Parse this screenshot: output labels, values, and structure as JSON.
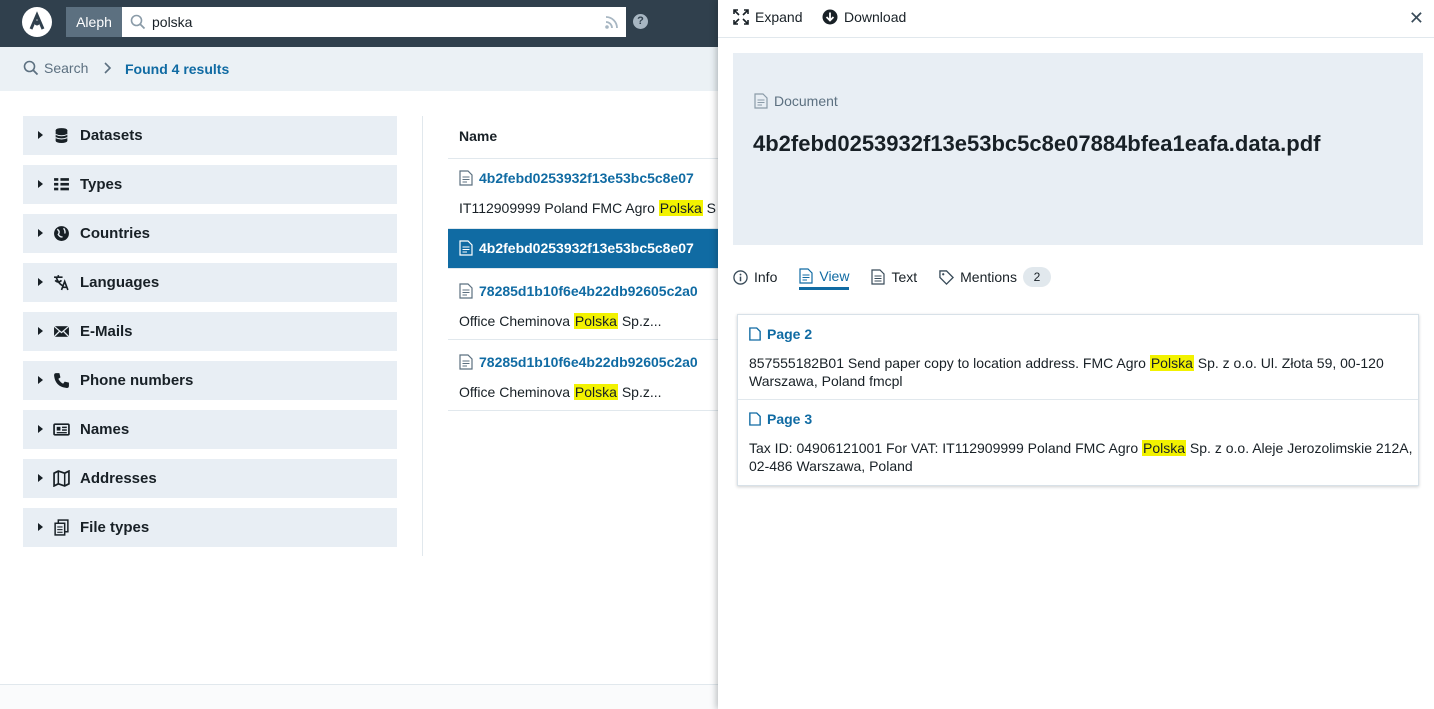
{
  "navbar": {
    "brand": "Aleph",
    "search_value": "polska",
    "logo_icon": "aleph-logo-icon",
    "search_icon": "search-icon",
    "rss_icon": "rss-icon",
    "help_label": "?"
  },
  "breadcrumbs": {
    "search_label": "Search",
    "results_label": "Found 4 results"
  },
  "facets": [
    {
      "label": "Datasets",
      "icon": "database-icon"
    },
    {
      "label": "Types",
      "icon": "list-icon"
    },
    {
      "label": "Countries",
      "icon": "globe-icon"
    },
    {
      "label": "Languages",
      "icon": "translate-icon"
    },
    {
      "label": "E-Mails",
      "icon": "envelope-icon"
    },
    {
      "label": "Phone numbers",
      "icon": "phone-icon"
    },
    {
      "label": "Names",
      "icon": "id-card-icon"
    },
    {
      "label": "Addresses",
      "icon": "map-icon"
    },
    {
      "label": "File types",
      "icon": "documents-icon"
    }
  ],
  "results": {
    "column_header": "Name",
    "rows": [
      {
        "title": "4b2febd0253932f13e53bc5c8e07",
        "snippet_before": "IT112909999 Poland FMC Agro ",
        "snippet_highlight": "Polska",
        "snippet_after": " S",
        "selected": false
      },
      {
        "title": "4b2febd0253932f13e53bc5c8e07",
        "snippet_before": "",
        "snippet_highlight": "",
        "snippet_after": "",
        "selected": true
      },
      {
        "title": "78285d1b10f6e4b22db92605c2a0",
        "snippet_before": "Office Cheminova ",
        "snippet_highlight": "Polska",
        "snippet_after": " Sp.z...",
        "selected": false
      },
      {
        "title": "78285d1b10f6e4b22db92605c2a0",
        "snippet_before": "Office Cheminova ",
        "snippet_highlight": "Polska",
        "snippet_after": " Sp.z...",
        "selected": false
      }
    ]
  },
  "preview": {
    "expand_label": "Expand",
    "download_label": "Download",
    "close_label": "✕",
    "type_label": "Document",
    "title": "4b2febd0253932f13e53bc5c8e07884bfea1eafa.data.pdf",
    "tabs": [
      {
        "label": "Info",
        "icon": "info-icon",
        "active": false
      },
      {
        "label": "View",
        "icon": "document-icon",
        "active": true
      },
      {
        "label": "Text",
        "icon": "text-document-icon",
        "active": false
      },
      {
        "label": "Mentions",
        "icon": "tag-icon",
        "active": false,
        "count": "2"
      }
    ],
    "mentions": [
      {
        "page": "Page 2",
        "before": "857555182B01 Send paper copy to location address. FMC Agro ",
        "highlight": "Polska",
        "after": " Sp. z o.o. Ul. Złota 59, 00-120 Warszawa, Poland fmcpl"
      },
      {
        "page": "Page 3",
        "before": "Tax ID: 04906121001 For VAT: IT112909999 Poland FMC Agro ",
        "highlight": "Polska",
        "after": " Sp. z o.o. Aleje Jerozolimskie 212A, 02-486 Warszawa, Poland"
      }
    ]
  },
  "colors": {
    "navbar": "#30404d",
    "accent": "#106ba3",
    "highlight": "#f2f200",
    "facet_bg": "#e8eef4"
  }
}
